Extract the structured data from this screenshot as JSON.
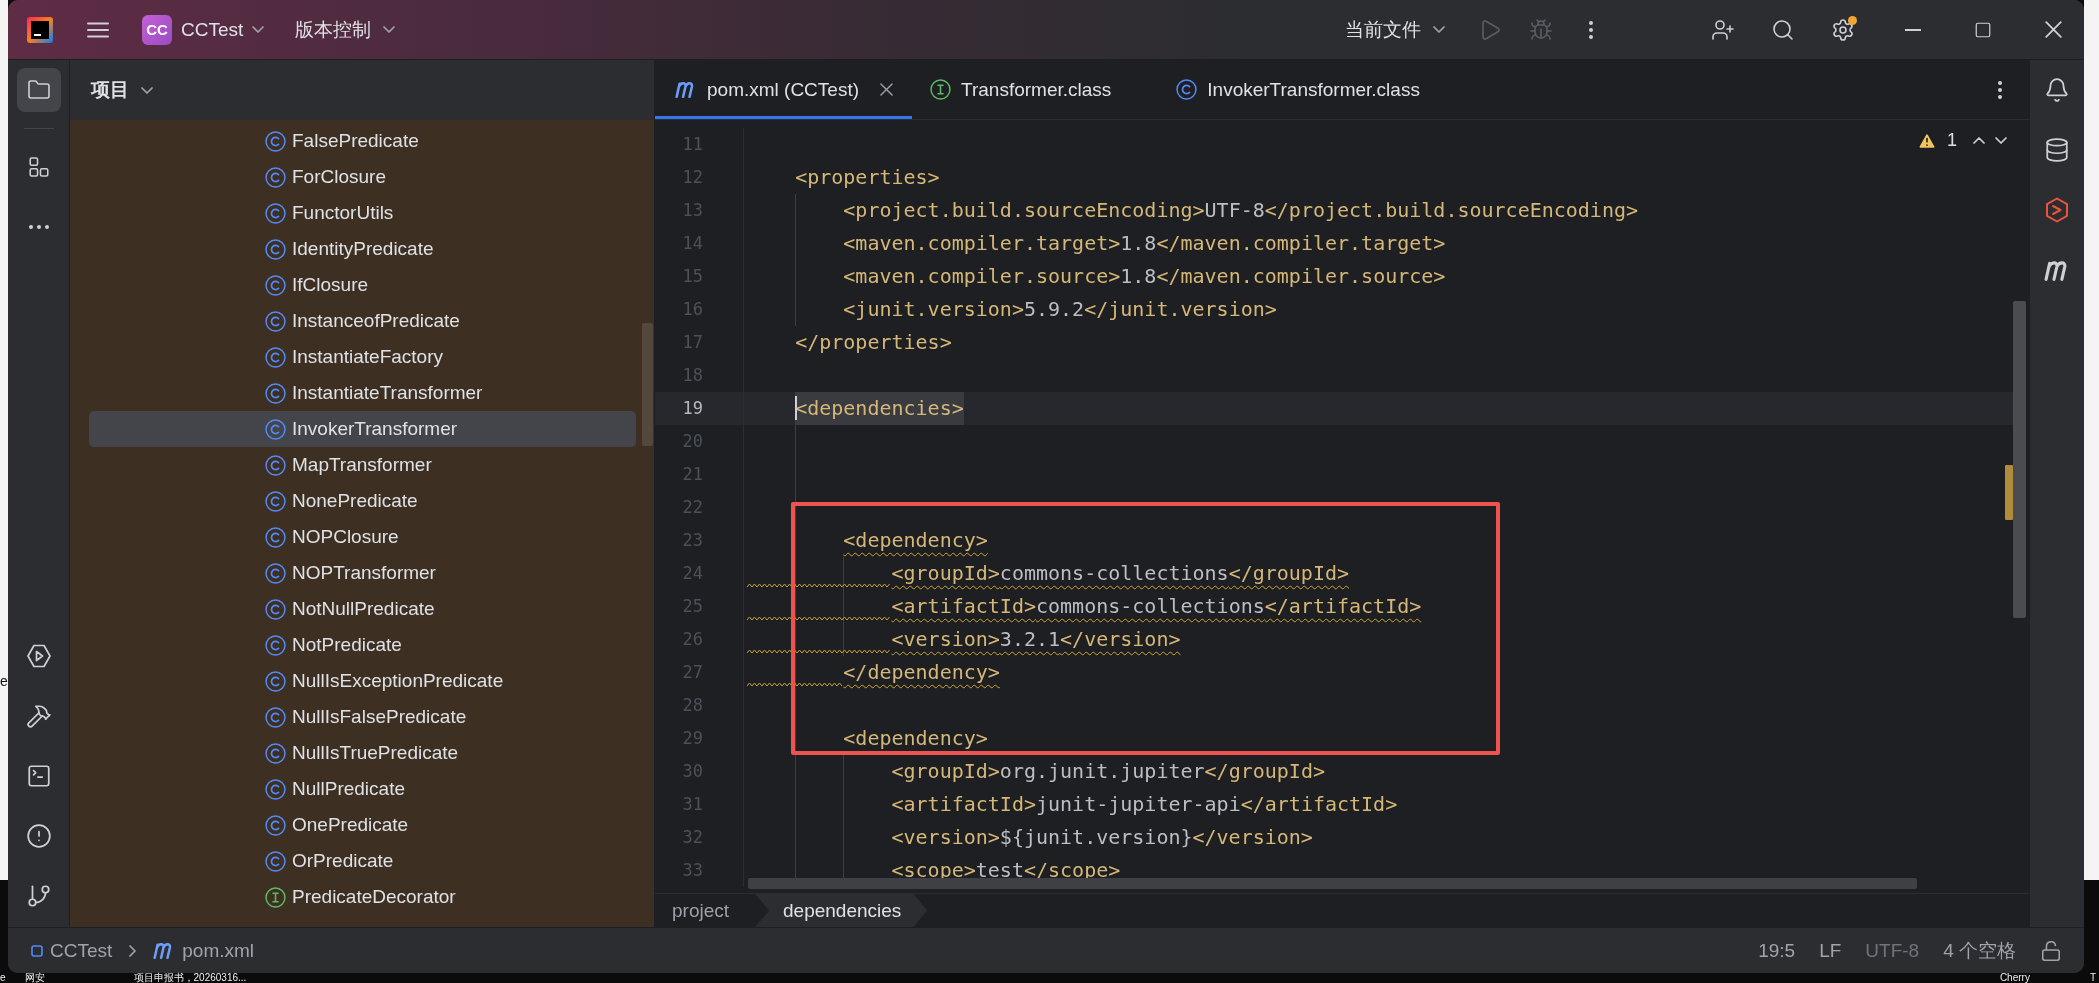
{
  "desktop": {
    "left_labels": [
      "e"
    ],
    "bottom_labels": [
      "e",
      "网安",
      "项目申报书，20260316..."
    ],
    "right_labels": [
      "Cherry",
      "T"
    ]
  },
  "title_bar": {
    "badge": "CC",
    "project": "CCTest",
    "vcs": "版本控制",
    "run_config": "当前文件",
    "actions": [
      {
        "kind": "run",
        "disabled": true
      },
      {
        "kind": "debug",
        "disabled": true
      },
      {
        "kind": "more",
        "disabled": false
      },
      {
        "kind": "add-user",
        "disabled": false
      },
      {
        "kind": "search",
        "disabled": false
      },
      {
        "kind": "settings",
        "disabled": false,
        "badge": true
      }
    ]
  },
  "left_toolbar": {
    "top": [
      {
        "kind": "project",
        "selected": true
      },
      {
        "kind": "structure",
        "selected": false
      },
      {
        "kind": "more",
        "selected": false
      }
    ],
    "bottom": [
      {
        "kind": "services",
        "selected": false
      },
      {
        "kind": "build",
        "selected": false
      },
      {
        "kind": "terminal",
        "selected": false
      },
      {
        "kind": "problems",
        "selected": false
      },
      {
        "kind": "git",
        "selected": false
      }
    ]
  },
  "project_panel": {
    "title": "项目",
    "items": [
      {
        "name": "FalsePredicate",
        "kind": "class",
        "selected": false
      },
      {
        "name": "ForClosure",
        "kind": "class",
        "selected": false
      },
      {
        "name": "FunctorUtils",
        "kind": "class",
        "selected": false
      },
      {
        "name": "IdentityPredicate",
        "kind": "class",
        "selected": false
      },
      {
        "name": "IfClosure",
        "kind": "class",
        "selected": false
      },
      {
        "name": "InstanceofPredicate",
        "kind": "class",
        "selected": false
      },
      {
        "name": "InstantiateFactory",
        "kind": "class",
        "selected": false
      },
      {
        "name": "InstantiateTransformer",
        "kind": "class",
        "selected": false
      },
      {
        "name": "InvokerTransformer",
        "kind": "class",
        "selected": true
      },
      {
        "name": "MapTransformer",
        "kind": "class",
        "selected": false
      },
      {
        "name": "NonePredicate",
        "kind": "class",
        "selected": false
      },
      {
        "name": "NOPClosure",
        "kind": "class",
        "selected": false
      },
      {
        "name": "NOPTransformer",
        "kind": "class",
        "selected": false
      },
      {
        "name": "NotNullPredicate",
        "kind": "class",
        "selected": false
      },
      {
        "name": "NotPredicate",
        "kind": "class",
        "selected": false
      },
      {
        "name": "NullIsExceptionPredicate",
        "kind": "class",
        "selected": false
      },
      {
        "name": "NullIsFalsePredicate",
        "kind": "class",
        "selected": false
      },
      {
        "name": "NullIsTruePredicate",
        "kind": "class",
        "selected": false
      },
      {
        "name": "NullPredicate",
        "kind": "class",
        "selected": false
      },
      {
        "name": "OnePredicate",
        "kind": "class",
        "selected": false
      },
      {
        "name": "OrPredicate",
        "kind": "class",
        "selected": false
      },
      {
        "name": "PredicateDecorator",
        "kind": "interface",
        "selected": false
      }
    ]
  },
  "editor": {
    "tabs": [
      {
        "label": "pom.xml (CCTest)",
        "kind": "maven",
        "selected": true
      },
      {
        "label": "Transformer.class",
        "kind": "interface",
        "selected": false
      },
      {
        "label": "InvokerTransformer.class",
        "kind": "class",
        "selected": false
      }
    ],
    "inspection": {
      "count": "1"
    },
    "lines": [
      {
        "kind": "line",
        "number": "11",
        "current": false
      },
      {
        "kind": "line",
        "number": "12",
        "code": "    <properties>",
        "current": false,
        "warning": false
      },
      {
        "kind": "line",
        "number": "13",
        "code": "        <project.build.sourceEncoding>UTF-8</project.build.sourceEncoding>",
        "current": false,
        "warning": false
      },
      {
        "kind": "line",
        "number": "14",
        "code": "        <maven.compiler.target>1.8</maven.compiler.target>",
        "current": false,
        "warning": false
      },
      {
        "kind": "line",
        "number": "15",
        "code": "        <maven.compiler.source>1.8</maven.compiler.source>",
        "current": false,
        "warning": false
      },
      {
        "kind": "line",
        "number": "16",
        "code": "        <junit.version>5.9.2</junit.version>",
        "current": false,
        "warning": false
      },
      {
        "kind": "line",
        "number": "17",
        "code": "    </properties>",
        "current": false,
        "warning": false
      },
      {
        "kind": "line",
        "number": "18",
        "current": false
      },
      {
        "kind": "line",
        "number": "19",
        "code": "    <dependencies>",
        "current": true,
        "warning": false
      },
      {
        "kind": "line",
        "number": "20",
        "current": false
      },
      {
        "kind": "line",
        "number": "21",
        "current": false
      },
      {
        "kind": "line",
        "number": "22",
        "current": false
      },
      {
        "kind": "annotation_box",
        "lines": [
          {
            "number": "23",
            "code": "        <dependency>",
            "current": false,
            "warning": true
          },
          {
            "number": "24",
            "code": "            <groupId>commons-collections</groupId>",
            "current": false,
            "warning": true
          },
          {
            "number": "25",
            "code": "            <artifactId>commons-collections</artifactId>",
            "current": false,
            "warning": true
          },
          {
            "number": "26",
            "code": "            <version>3.2.1</version>",
            "current": false,
            "warning": true
          },
          {
            "number": "27",
            "code": "        </dependency>",
            "current": false,
            "warning": true
          },
          {
            "number": "28",
            "current": false
          },
          {
            "number": "29",
            "code": "        <dependency>",
            "current": false,
            "warning": false
          }
        ]
      },
      {
        "kind": "line",
        "number": "30",
        "code": "            <groupId>org.junit.jupiter</groupId>",
        "current": false,
        "warning": false
      },
      {
        "kind": "line",
        "number": "31",
        "code": "            <artifactId>junit-jupiter-api</artifactId>",
        "current": false,
        "warning": false
      },
      {
        "kind": "line",
        "number": "32",
        "code": "            <version>${junit.version}</version>",
        "current": false,
        "warning": false
      },
      {
        "kind": "line",
        "number": "33",
        "code": "            <scope>test</scope>",
        "current": false,
        "warning": false
      }
    ],
    "breadcrumbs": [
      {
        "label": "project",
        "selected": false
      },
      {
        "label": "dependencies",
        "selected": true
      }
    ]
  },
  "right_toolbar": [
    {
      "kind": "notifications",
      "selected": false
    },
    {
      "kind": "database",
      "selected": false
    },
    {
      "kind": "plugin",
      "selected": false
    },
    {
      "kind": "maven",
      "selected": false
    }
  ],
  "status_bar": {
    "path": [
      {
        "label": "CCTest",
        "kind": "module"
      },
      {
        "label": "pom.xml",
        "kind": "maven"
      }
    ],
    "items": [
      {
        "label": "19:5",
        "muted": false
      },
      {
        "label": "LF",
        "muted": false
      },
      {
        "label": "UTF-8",
        "muted": true
      },
      {
        "label": "4 个空格",
        "muted": false
      }
    ],
    "read_only": false
  }
}
